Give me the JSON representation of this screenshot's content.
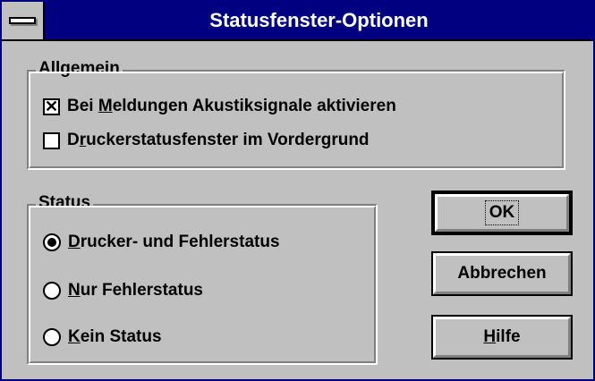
{
  "window": {
    "title": "Statusfenster-Optionen"
  },
  "general_group": {
    "legend": "Allgemein",
    "options": [
      {
        "prefix": "Bei ",
        "accel": "M",
        "suffix": "eldungen Akustiksignale aktivieren",
        "checked": true
      },
      {
        "prefix": "D",
        "accel": "r",
        "suffix": "uckerstatusfenster im Vordergrund",
        "checked": false
      }
    ]
  },
  "status_group": {
    "legend": "Status",
    "options": [
      {
        "prefix": "",
        "accel": "D",
        "suffix": "rucker- und Fehlerstatus",
        "selected": true
      },
      {
        "prefix": "",
        "accel": "N",
        "suffix": "ur Fehlerstatus",
        "selected": false
      },
      {
        "prefix": "",
        "accel": "K",
        "suffix": "ein Status",
        "selected": false
      }
    ]
  },
  "buttons": {
    "ok": {
      "label": "OK"
    },
    "cancel": {
      "label": "Abbrechen"
    },
    "help": {
      "prefix": "",
      "accel": "H",
      "suffix": "ilfe"
    }
  },
  "check_mark": "✕"
}
